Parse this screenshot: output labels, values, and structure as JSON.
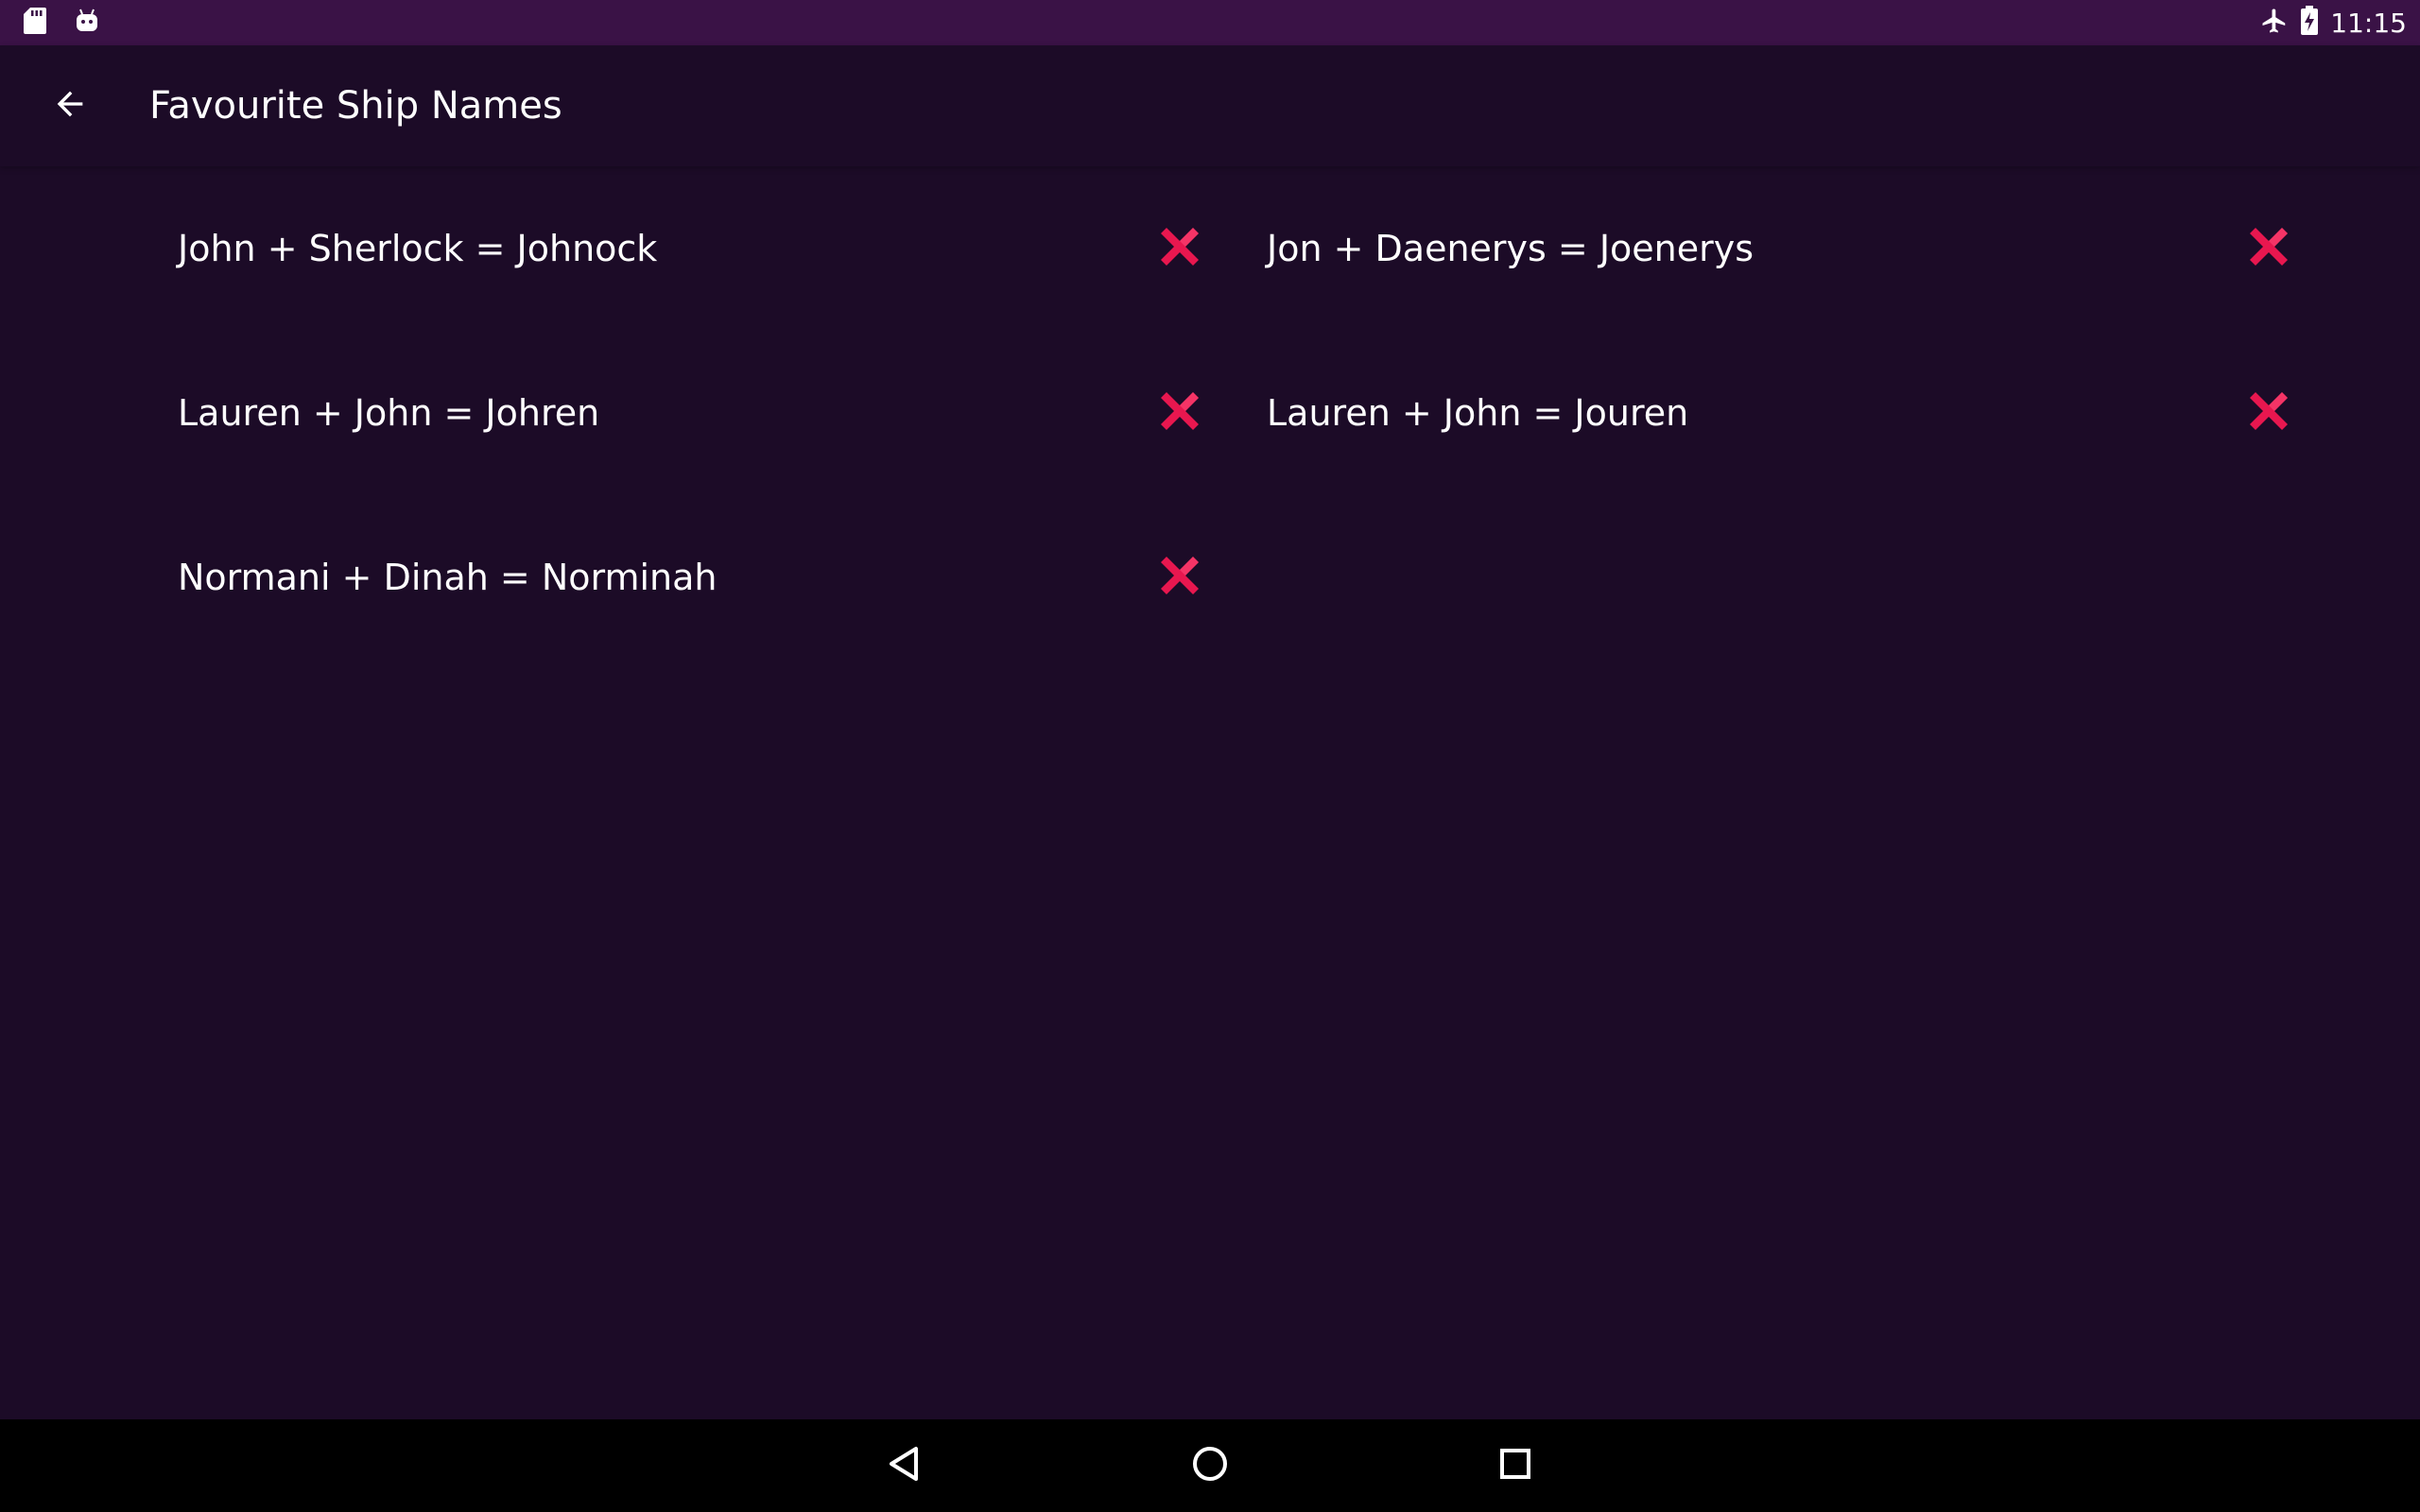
{
  "status_bar": {
    "time": "11:15",
    "icons": [
      "sd-card-icon",
      "android-icon",
      "airplane-mode-icon",
      "battery-charging-icon"
    ]
  },
  "app_bar": {
    "title": "Favourite Ship Names",
    "back_icon": "arrow-back-icon"
  },
  "ships": [
    {
      "text": "John + Sherlock = Johnock"
    },
    {
      "text": "Jon + Daenerys = Joenerys"
    },
    {
      "text": "Lauren + John = Johren"
    },
    {
      "text": "Lauren + John = Jouren"
    },
    {
      "text": "Normani + Dinah = Norminah"
    }
  ],
  "nav_bar": {
    "icons": [
      "nav-back-icon",
      "nav-home-icon",
      "nav-recents-icon"
    ]
  },
  "colors": {
    "status_bar": "#3a1246",
    "background": "#1c0b27",
    "delete_accent": "#e8174f",
    "nav_bar": "#000000"
  }
}
